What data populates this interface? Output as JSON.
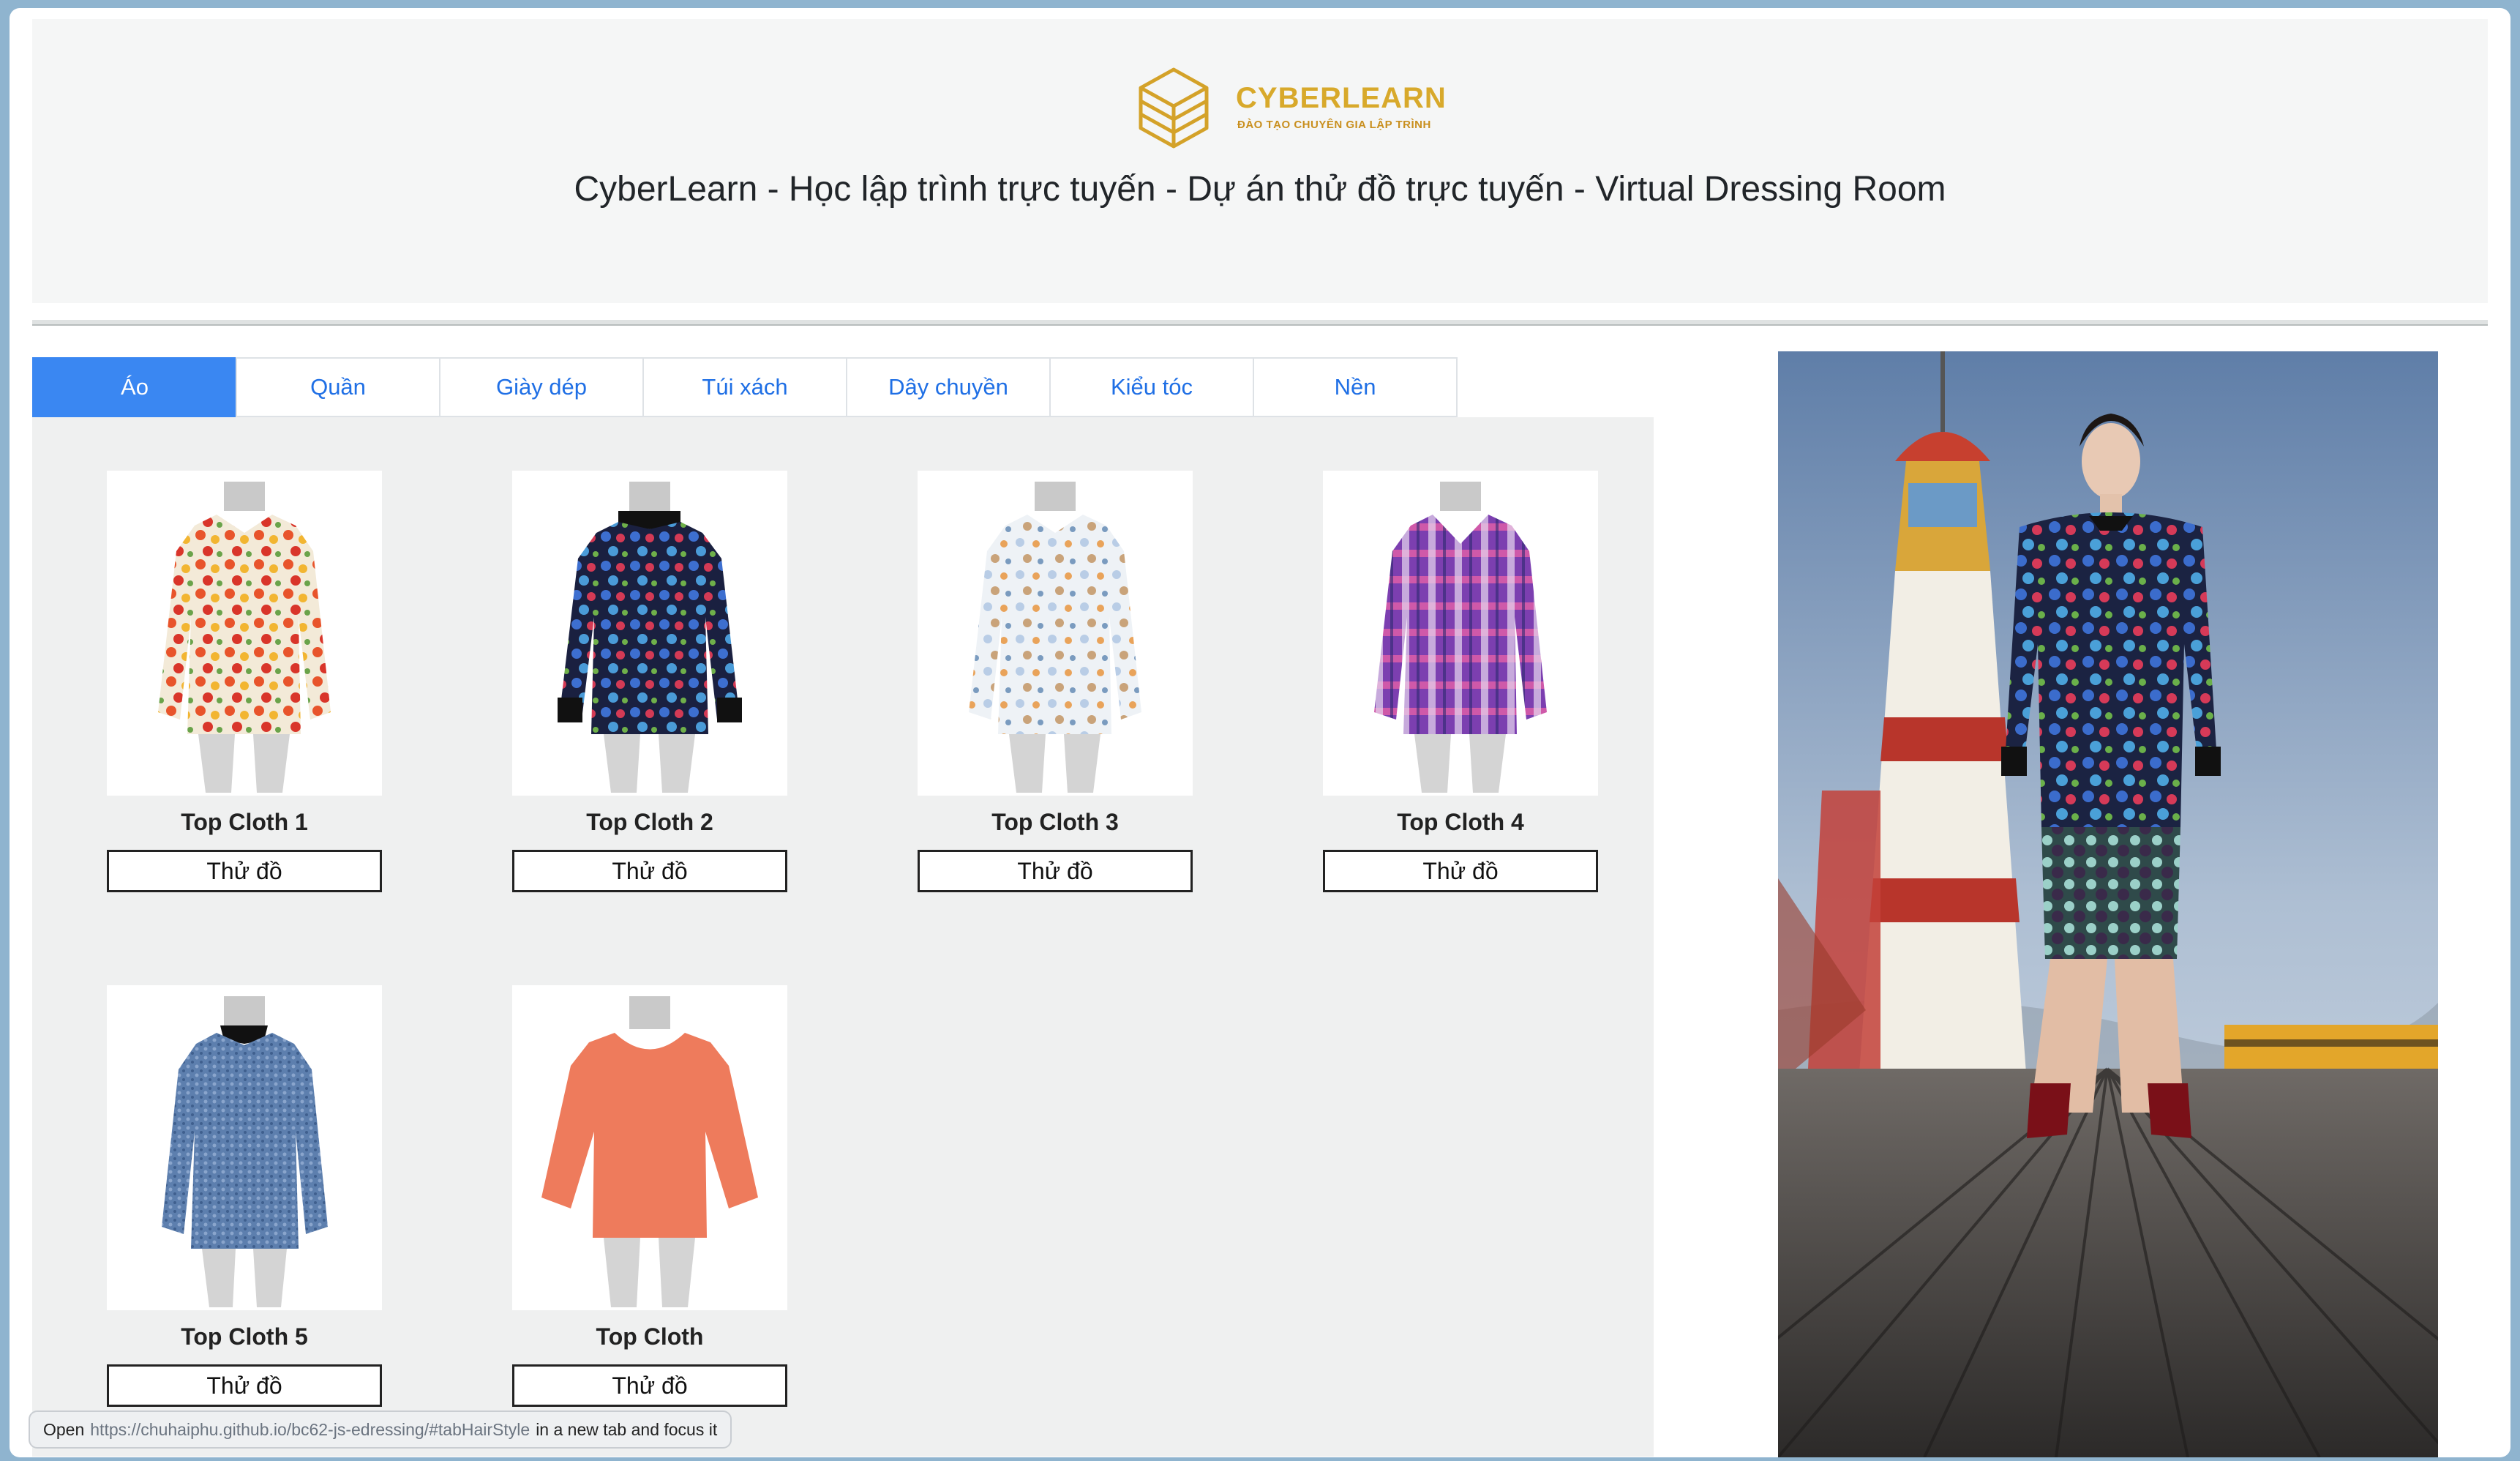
{
  "header": {
    "logo_name": "CYBERLEARN",
    "logo_tagline": "ĐÀO TẠO CHUYÊN GIA LẬP TRÌNH",
    "title": "CyberLearn - Học lập trình trực tuyến - Dự án thử đồ trực tuyến - Virtual Dressing Room"
  },
  "tabs": [
    {
      "label": "Áo",
      "active": true
    },
    {
      "label": "Quần"
    },
    {
      "label": "Giày dép"
    },
    {
      "label": "Túi xách"
    },
    {
      "label": "Dây chuyền"
    },
    {
      "label": "Kiểu tóc"
    },
    {
      "label": "Nền"
    }
  ],
  "items": [
    {
      "name": "Top Cloth 1",
      "button": "Thử đồ",
      "pattern": "floral-cream"
    },
    {
      "name": "Top Cloth 2",
      "button": "Thử đồ",
      "pattern": "floral-dark"
    },
    {
      "name": "Top Cloth 3",
      "button": "Thử đồ",
      "pattern": "floral-white"
    },
    {
      "name": "Top Cloth 4",
      "button": "Thử đồ",
      "pattern": "plaid-purple"
    },
    {
      "name": "Top Cloth 5",
      "button": "Thử đồ",
      "pattern": "denim"
    },
    {
      "name": "Top Cloth",
      "button": "Thử đồ",
      "pattern": "coral"
    }
  ],
  "status_bar": {
    "prefix": "Open",
    "url": "https://chuhaiphu.github.io/bc62-js-edressing/#tabHairStyle",
    "suffix": "in a new tab and focus it"
  },
  "colors": {
    "accent": "#3a87f2",
    "tab_text": "#1f6fe5",
    "panel_bg": "#eff0f0",
    "logo_gold": "#d8a92b"
  }
}
